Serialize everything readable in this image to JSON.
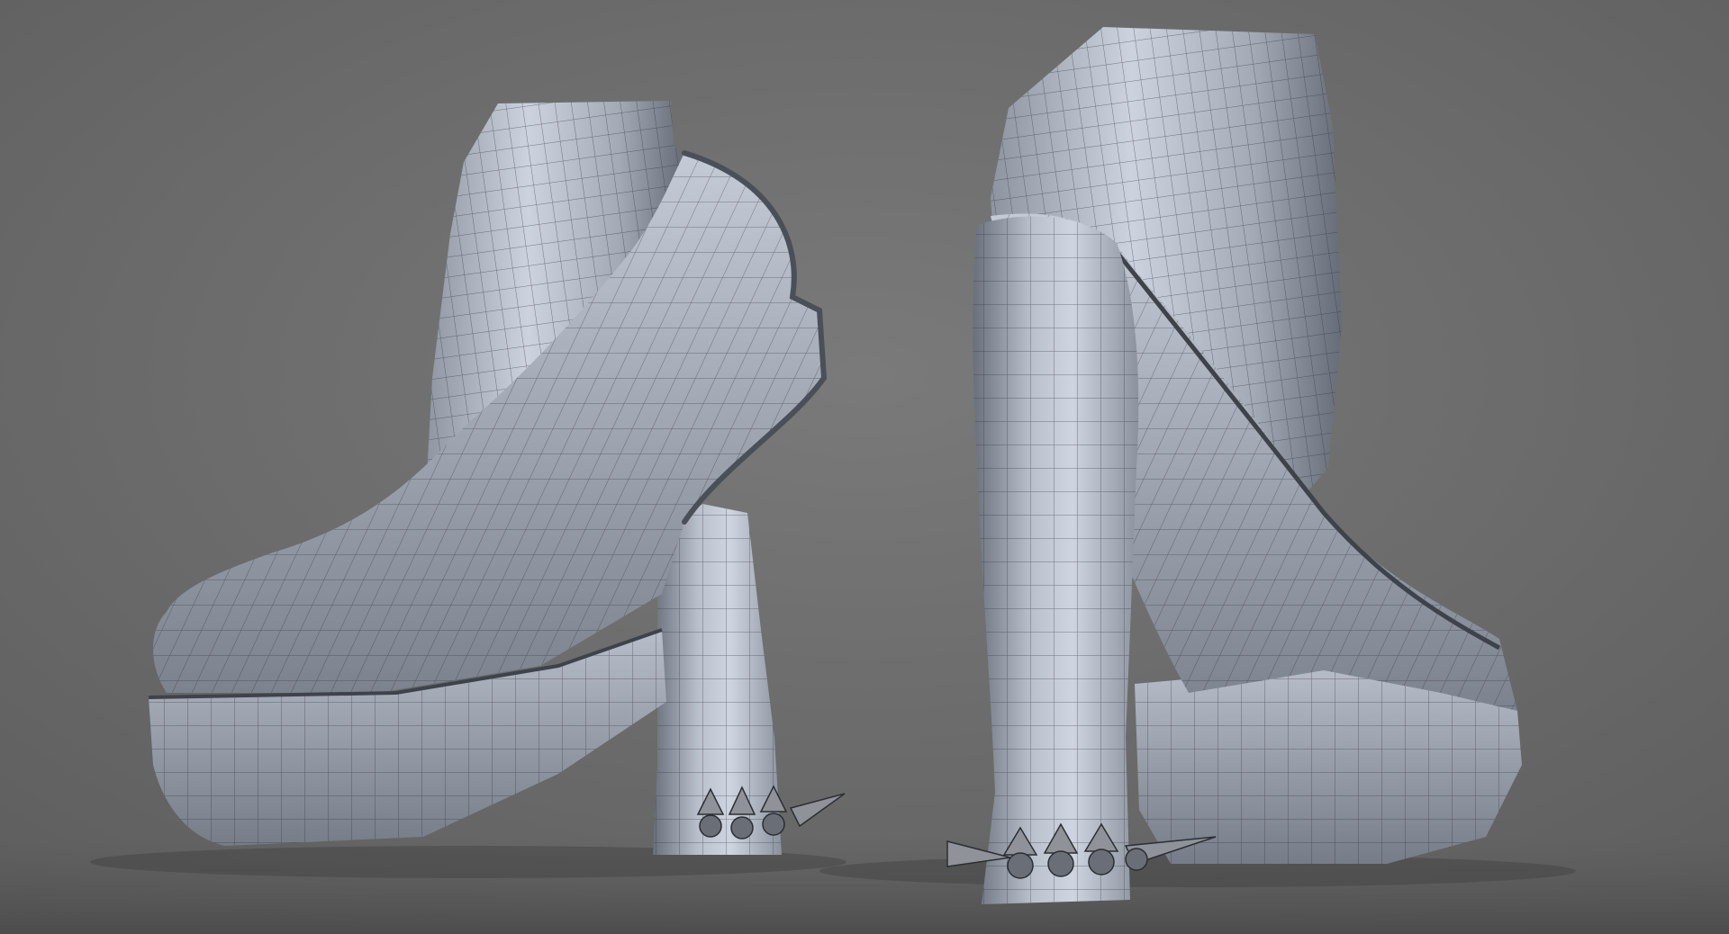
{
  "scene": {
    "subject": "high-heel-platform-shoes",
    "render_style": "wireframe-clay",
    "colors": {
      "background": "#6f6f6f",
      "floor": "#5a5a5a",
      "clay_light": "#c9cfdb",
      "clay_mid": "#9aa1ad",
      "clay_dark": "#5c626d",
      "wire": "#2b2e33",
      "spike": "#8f9399"
    }
  }
}
